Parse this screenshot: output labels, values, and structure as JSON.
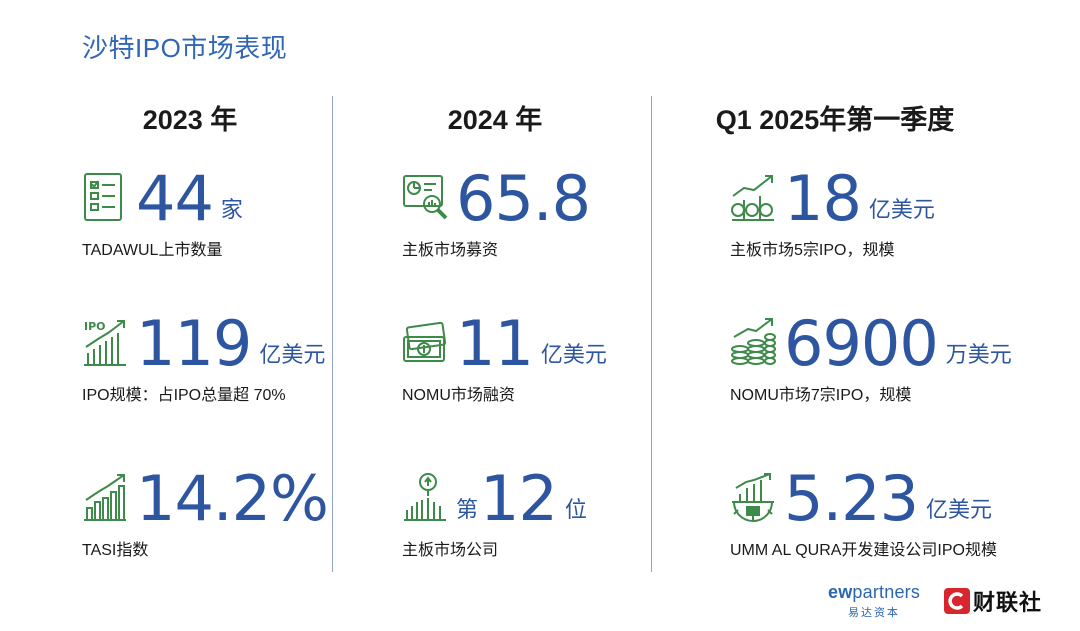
{
  "title": "沙特IPO市场表现",
  "columns": [
    {
      "heading": "2023 年",
      "stats": [
        {
          "icon": "checklist-icon",
          "value": "44",
          "prefix": "",
          "unit": "家",
          "label": "TADAWUL上市数量"
        },
        {
          "icon": "ipo-growth-chart-icon",
          "value": "119",
          "prefix": "",
          "unit": "亿美元",
          "label": "IPO规模：占IPO总量超 70%"
        },
        {
          "icon": "bar-chart-up-arrow-icon",
          "value": "14.2%",
          "prefix": "",
          "unit": "",
          "label": "TASI指数"
        }
      ]
    },
    {
      "heading": "2024 年",
      "stats": [
        {
          "icon": "chart-magnifier-icon",
          "value": "65.8",
          "prefix": "",
          "unit": "",
          "label": "主板市场募资"
        },
        {
          "icon": "banknotes-icon",
          "value": "11",
          "prefix": "",
          "unit": "亿美元",
          "label": "NOMU市场融资"
        },
        {
          "icon": "ranking-chart-icon",
          "value": "12",
          "prefix": "第",
          "unit": "位",
          "label": "主板市场公司"
        }
      ]
    },
    {
      "heading": "Q1 2025年第一季度",
      "stats": [
        {
          "icon": "coins-growth-icon",
          "value": "18",
          "prefix": "",
          "unit": "亿美元",
          "label": "主板市场5宗IPO，规模"
        },
        {
          "icon": "coin-stack-arrow-icon",
          "value": "6900",
          "prefix": "",
          "unit": "万美元",
          "label": "NOMU市场7宗IPO，规模"
        },
        {
          "icon": "gear-chart-icon",
          "value": "5.23",
          "prefix": "",
          "unit": "亿美元",
          "label": "UMM AL QURA开发建设公司IPO规模"
        }
      ]
    }
  ],
  "branding": {
    "ew_main_bold": "ew",
    "ew_main_rest": "partners",
    "ew_sub": "易达资本",
    "cls_text": "财联社"
  },
  "colors": {
    "title": "#2f66b5",
    "value": "#2d55a0",
    "icon_green": "#3e8a4a",
    "divider": "#8ea6c6",
    "cls_red": "#d7262e"
  }
}
